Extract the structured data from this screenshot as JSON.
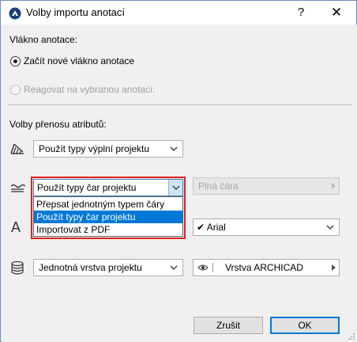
{
  "window": {
    "title": "Volby importu anotací",
    "help_symbol": "?",
    "close_symbol": "✕"
  },
  "thread": {
    "heading": "Vlákno anotace:",
    "option_new": "Začít nové vlákno anotace",
    "option_new_selected": true,
    "option_reply": "Reagovat na vybranou anotaci:",
    "option_reply_enabled": false
  },
  "transfer": {
    "heading": "Volby přenosu atributů:",
    "fill_type": {
      "icon": "fill-pattern-icon",
      "value": "Použít typy výplní projektu"
    },
    "line_type": {
      "icon": "line-type-icon",
      "value": "Použít typy čar projektu",
      "options": [
        "Přepsat jednotným typem čáry",
        "Použít typy čar projektu",
        "Importovat z PDF"
      ],
      "selected_index": 1,
      "secondary_value": "Plná čára",
      "secondary_enabled": false
    },
    "font": {
      "icon": "font-icon",
      "icon_glyph": "A",
      "check_glyph": "✔",
      "value": "Arial"
    },
    "layer": {
      "icon": "layers-icon",
      "value": "Jednotná vrstva projektu",
      "layer_value": "Vrstva ARCHICAD",
      "eye_icon": "eye-icon"
    }
  },
  "buttons": {
    "cancel": "Zrušit",
    "ok": "OK"
  }
}
